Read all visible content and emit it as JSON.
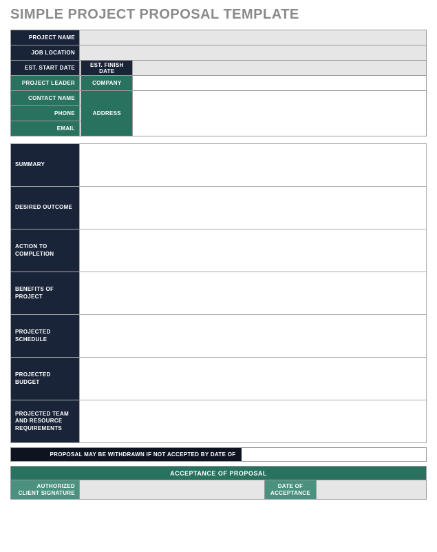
{
  "title": "SIMPLE PROJECT PROPOSAL TEMPLATE",
  "header": {
    "project_name_label": "PROJECT NAME",
    "project_name_value": "",
    "job_location_label": "JOB LOCATION",
    "job_location_value": "",
    "est_start_label": "EST. START DATE",
    "est_start_value": "",
    "est_finish_label": "EST. FINISH DATE",
    "est_finish_value": "",
    "project_leader_label": "PROJECT LEADER",
    "project_leader_value": "",
    "company_label": "COMPANY",
    "company_value": "",
    "contact_name_label": "CONTACT NAME",
    "contact_name_value": "",
    "address_label": "ADDRESS",
    "address_value": "",
    "phone_label": "PHONE",
    "phone_value": "",
    "email_label": "EMAIL",
    "email_value": ""
  },
  "details": {
    "summary_label": "SUMMARY",
    "summary_value": "",
    "desired_outcome_label": "DESIRED OUTCOME",
    "desired_outcome_value": "",
    "action_label": "ACTION TO COMPLETION",
    "action_value": "",
    "benefits_label": "BENEFITS OF PROJECT",
    "benefits_value": "",
    "schedule_label": "PROJECTED SCHEDULE",
    "schedule_value": "",
    "budget_label": "PROJECTED BUDGET",
    "budget_value": "",
    "team_label": "PROJECTED TEAM AND RESOURCE REQUIREMENTS",
    "team_value": ""
  },
  "withdraw": {
    "label": "PROPOSAL MAY BE WITHDRAWN IF NOT ACCEPTED BY DATE OF",
    "value": ""
  },
  "acceptance": {
    "heading": "ACCEPTANCE OF PROPOSAL",
    "signature_label": "AUTHORIZED CLIENT SIGNATURE",
    "signature_value": "",
    "date_label": "DATE OF ACCEPTANCE",
    "date_value": ""
  }
}
